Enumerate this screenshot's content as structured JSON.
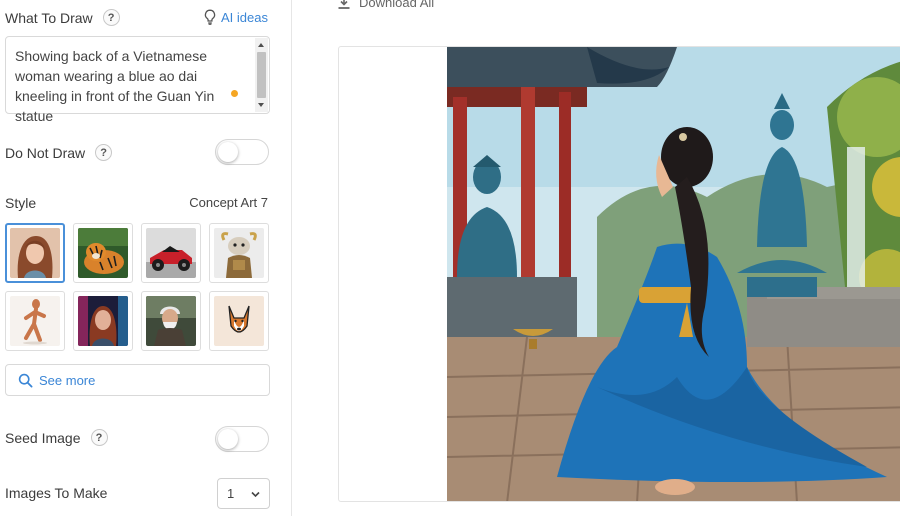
{
  "prompt": {
    "label": "What To Draw",
    "help": "?",
    "ai_ideas_label": "AI ideas",
    "text": "Showing back of a Vietnamese woman wearing a blue ao dai kneeling in front of the Guan Yin statue",
    "accent_color": "#3b86d6",
    "indicator_color": "#f5a623"
  },
  "do_not_draw": {
    "label": "Do Not Draw",
    "help": "?",
    "enabled": false
  },
  "style": {
    "label": "Style",
    "current": "Concept Art 7",
    "thumbnails": [
      {
        "name": "portrait woman",
        "selected": true
      },
      {
        "name": "tiger",
        "selected": false
      },
      {
        "name": "race car",
        "selected": false
      },
      {
        "name": "robot bull",
        "selected": false
      },
      {
        "name": "wooden mannequin",
        "selected": false
      },
      {
        "name": "neon woman",
        "selected": false
      },
      {
        "name": "old man",
        "selected": false
      },
      {
        "name": "dog logo",
        "selected": false
      }
    ]
  },
  "see_more": {
    "label": "See more",
    "icon": "search-icon"
  },
  "seed_image": {
    "label": "Seed Image",
    "help": "?",
    "enabled": false
  },
  "images_to_make": {
    "label": "Images To Make",
    "value": "1",
    "icon": "chevron-down-icon"
  },
  "download": {
    "label": "Download All",
    "icon": "download-icon"
  }
}
